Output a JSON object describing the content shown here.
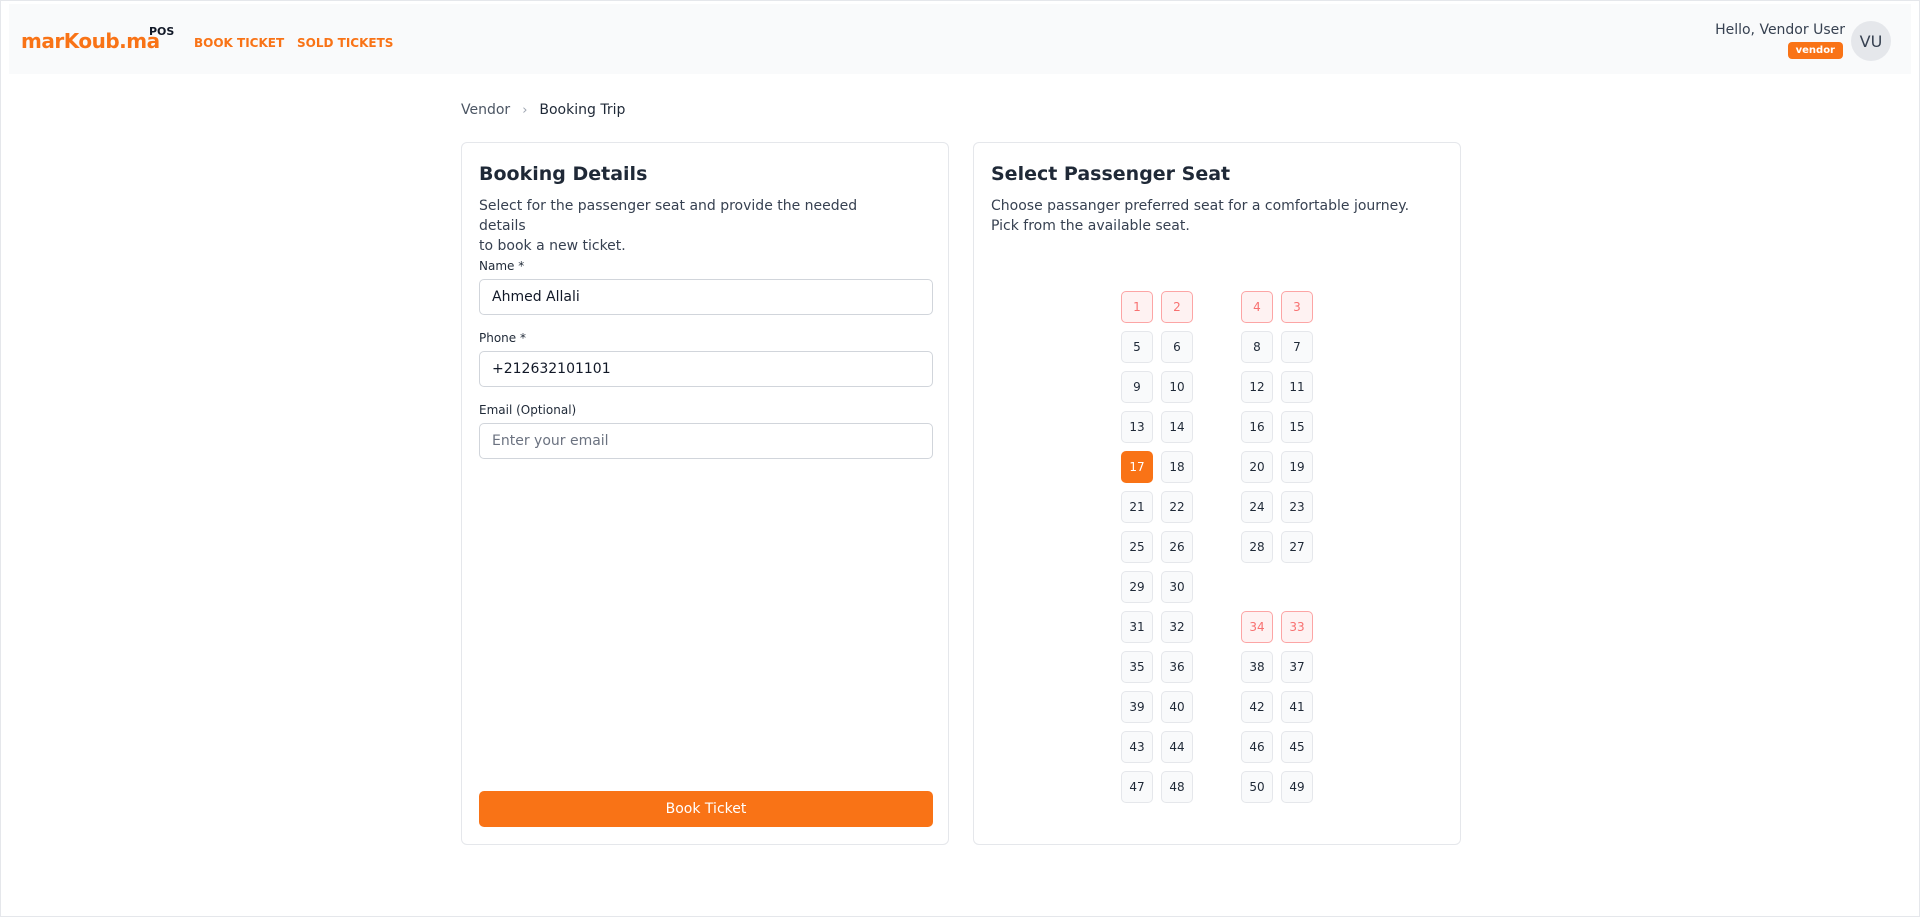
{
  "header": {
    "logo_text": "marKoub.ma",
    "logo_suffix": "POS",
    "nav": {
      "book_ticket": "BOOK TICKET",
      "sold_tickets": "SOLD TICKETS"
    },
    "greeting": "Hello, Vendor User",
    "role_badge": "vendor",
    "avatar_initials": "VU"
  },
  "breadcrumb": {
    "root": "Vendor",
    "separator": "›",
    "current": "Booking Trip"
  },
  "booking": {
    "title": "Booking Details",
    "description": "Select for the passenger seat and provide the needed details\nto book a new ticket.",
    "name_label": "Name *",
    "name_value": "Ahmed Allali",
    "phone_label": "Phone *",
    "phone_value": "+212632101101",
    "email_label": "Email (Optional)",
    "email_value": "",
    "email_placeholder": "Enter your email",
    "submit_label": "Book Ticket"
  },
  "seats": {
    "title": "Select Passenger Seat",
    "description": "Choose passanger preferred seat for a comfortable journey.\nPick from the available seat.",
    "rows": [
      [
        "1",
        "2",
        "4",
        "3"
      ],
      [
        "5",
        "6",
        "8",
        "7"
      ],
      [
        "9",
        "10",
        "12",
        "11"
      ],
      [
        "13",
        "14",
        "16",
        "15"
      ],
      [
        "17",
        "18",
        "20",
        "19"
      ],
      [
        "21",
        "22",
        "24",
        "23"
      ],
      [
        "25",
        "26",
        "28",
        "27"
      ],
      [
        "29",
        "30",
        "",
        ""
      ],
      [
        "31",
        "32",
        "34",
        "33"
      ],
      [
        "35",
        "36",
        "38",
        "37"
      ],
      [
        "39",
        "40",
        "42",
        "41"
      ],
      [
        "43",
        "44",
        "46",
        "45"
      ],
      [
        "47",
        "48",
        "50",
        "49"
      ]
    ],
    "booked": [
      "1",
      "2",
      "3",
      "4",
      "33",
      "34"
    ],
    "selected": "17"
  },
  "colors": {
    "accent": "#f97316",
    "booked_bg": "#fef2f2",
    "booked_border": "#fca5a5"
  }
}
